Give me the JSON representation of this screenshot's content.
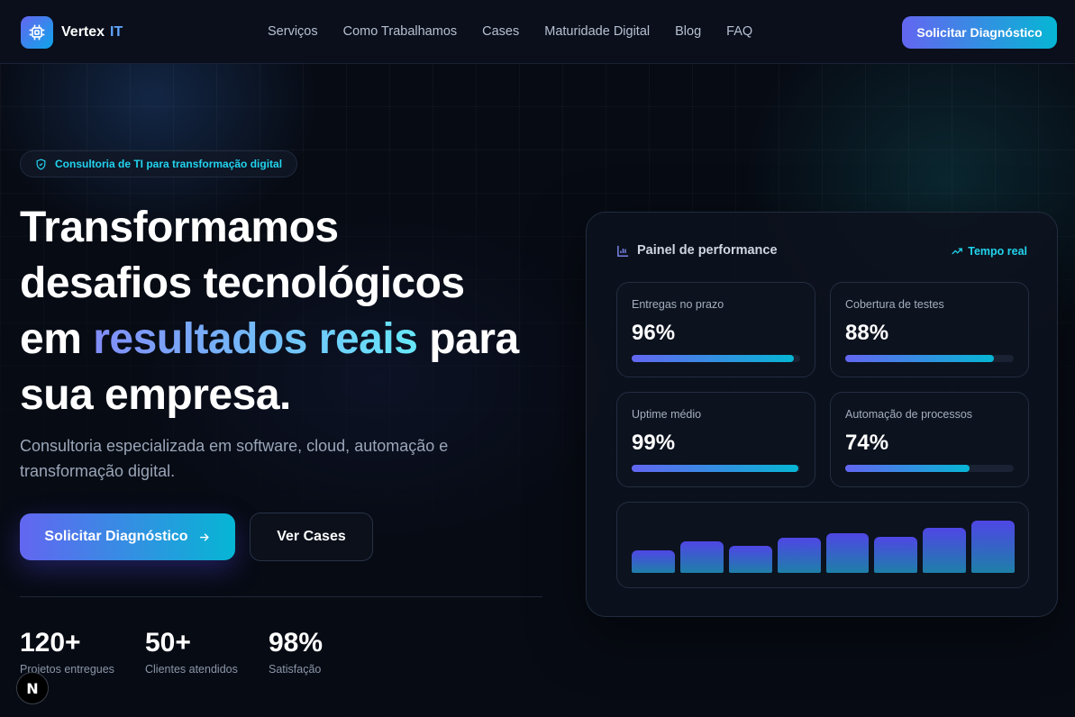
{
  "brand": {
    "name": "Vertex",
    "accent": "IT",
    "icon": "cpu-chip-icon",
    "colors": {
      "primary": "#6366f1",
      "secondary": "#06b6d4",
      "accent_text": "#22d3ee"
    }
  },
  "nav": {
    "links": [
      "Serviços",
      "Como Trabalhamos",
      "Cases",
      "Maturidade Digital",
      "Blog",
      "FAQ"
    ],
    "cta": "Solicitar Diagnóstico"
  },
  "hero": {
    "badge": {
      "icon": "shield-check-icon",
      "text": "Consultoria de TI para transformação digital"
    },
    "headline": {
      "line1": "Transformamos",
      "line2": "desafios tecnológicos",
      "line3_pre": "em ",
      "line3_highlight": "resultados reais",
      "line3_post": " para",
      "line4": "sua empresa."
    },
    "subtitle": "Consultoria especializada em software, cloud, automação e transformação digital.",
    "primary_cta": "Solicitar Diagnóstico",
    "primary_cta_icon": "arrow-right-icon",
    "secondary_cta": "Ver Cases"
  },
  "stats": [
    {
      "value": "120+",
      "label": "Projetos entregues"
    },
    {
      "value": "50+",
      "label": "Clientes atendidos"
    },
    {
      "value": "98%",
      "label": "Satisfação"
    }
  ],
  "dev_badge": {
    "text": "N",
    "icon": "nextjs-icon"
  },
  "dashboard": {
    "title": "Painel de performance",
    "title_icon": "bar-chart-icon",
    "live_label": "Tempo real",
    "live_icon": "trending-up-icon",
    "metrics": [
      {
        "label": "Entregas no prazo",
        "value": "96%",
        "progress": 0.96
      },
      {
        "label": "Cobertura de testes",
        "value": "88%",
        "progress": 0.88
      },
      {
        "label": "Uptime médio",
        "value": "99%",
        "progress": 0.99
      },
      {
        "label": "Automação de processos",
        "value": "74%",
        "progress": 0.74
      }
    ],
    "mini_chart": {
      "type": "bar",
      "values": [
        0.4,
        0.55,
        0.48,
        0.62,
        0.7,
        0.64,
        0.8,
        0.92
      ]
    }
  }
}
